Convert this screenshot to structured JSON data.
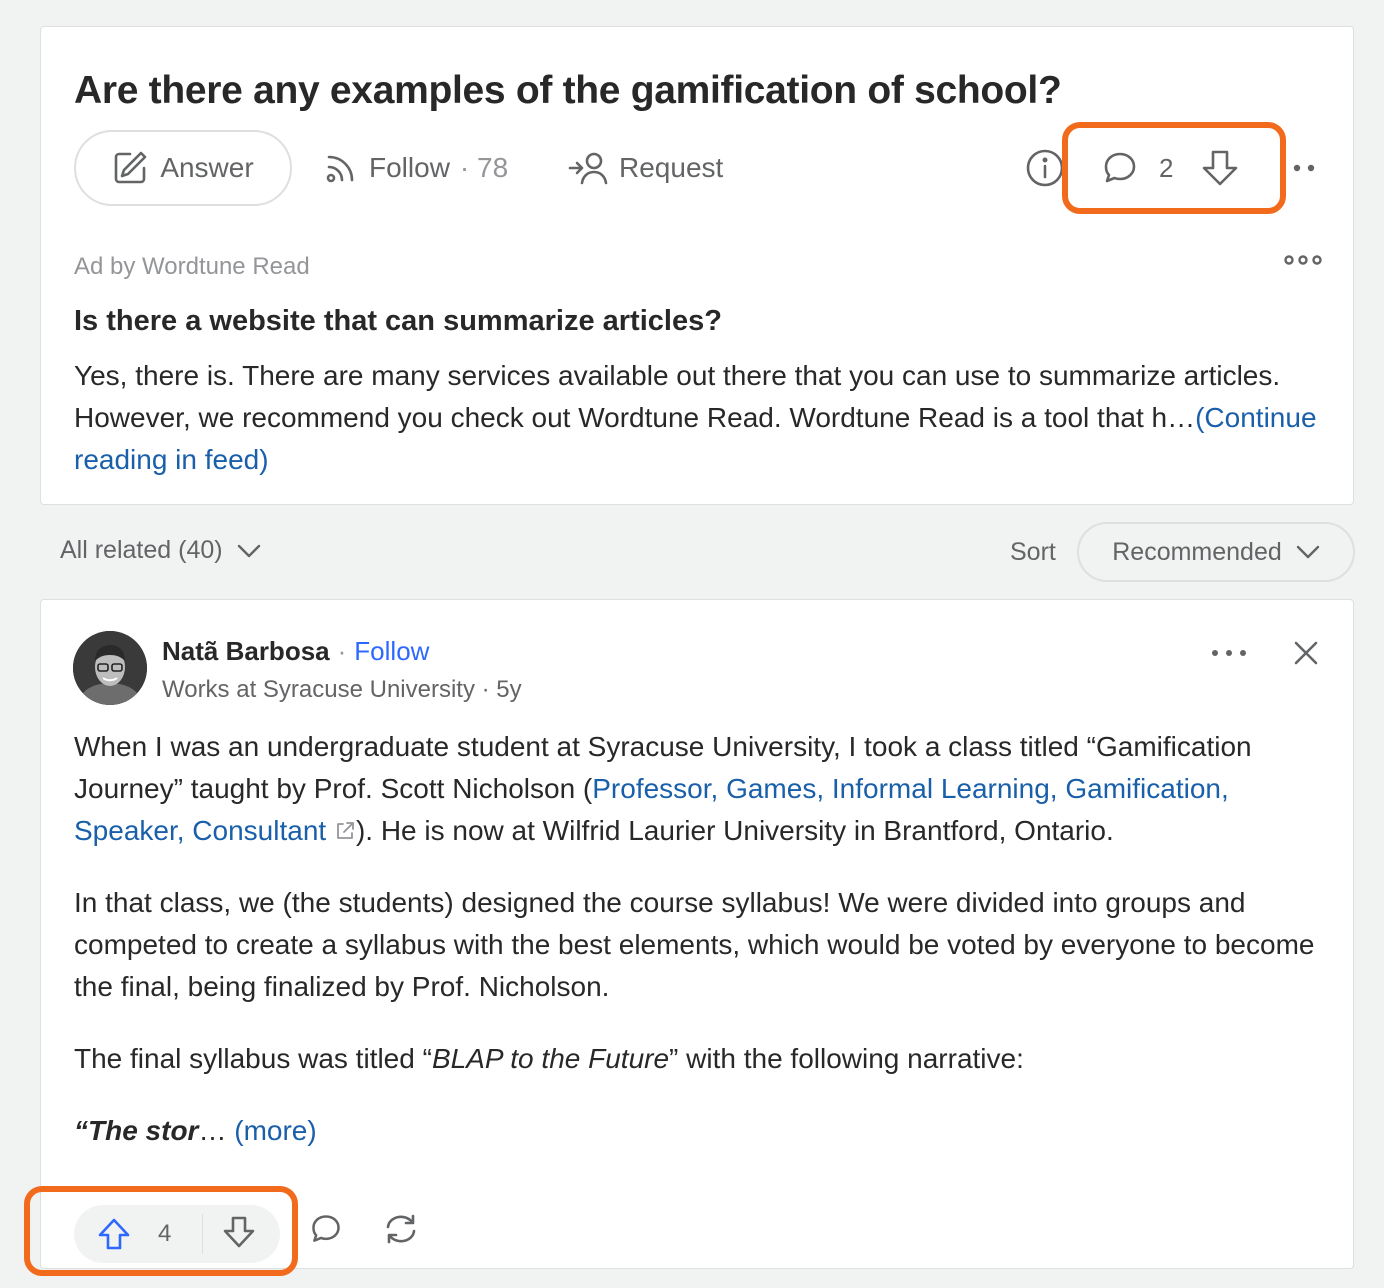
{
  "question": {
    "title": "Are there any examples of the gamification of school?",
    "answer_label": "Answer",
    "follow_label": "Follow",
    "follow_count": "· 78",
    "request_label": "Request",
    "comment_count": "2"
  },
  "ad": {
    "label": "Ad by Wordtune Read",
    "title": "Is there a website that can summarize articles?",
    "body": "Yes, there is. There are many services available out there that you can use to summarize articles. However, we recommend you check out Wordtune Read. Wordtune Read is a tool that h…",
    "continue_link": "(Continue reading in feed)"
  },
  "related": {
    "label": "All related (40)",
    "sort_label": "Sort",
    "sort_value": "Recommended"
  },
  "answer": {
    "author_name": "Natã Barbosa",
    "separator": "·",
    "follow_label": "Follow",
    "credential": "Works at Syracuse University · 5y",
    "p1_before": "When I was an undergraduate student at Syracuse University, I took a class titled “Gamification Journey” taught by Prof. Scott Nicholson (",
    "p1_link": "Professor, Games, Informal Learning, Gamification, Speaker, Consultant",
    "p1_after": "). He is now at Wilfrid Laurier University in Brantford, Ontario.",
    "p2": "In that class, we (the students) designed the course syllabus! We were divided into groups and competed to create a syllabus with the best elements, which would be voted by everyone to become the final, being finalized by Prof. Nicholson.",
    "p3_before": "The final syllabus was titled “",
    "p3_italic": "BLAP to the Future",
    "p3_after": "” with the following narrative:",
    "p4_bold": "“The stor",
    "p4_ellipsis": "…",
    "more_link": "(more)",
    "upvote_count": "4"
  },
  "colors": {
    "highlight": "#f26b1d",
    "link": "#2e69ff",
    "upvote": "#2e69ff"
  }
}
